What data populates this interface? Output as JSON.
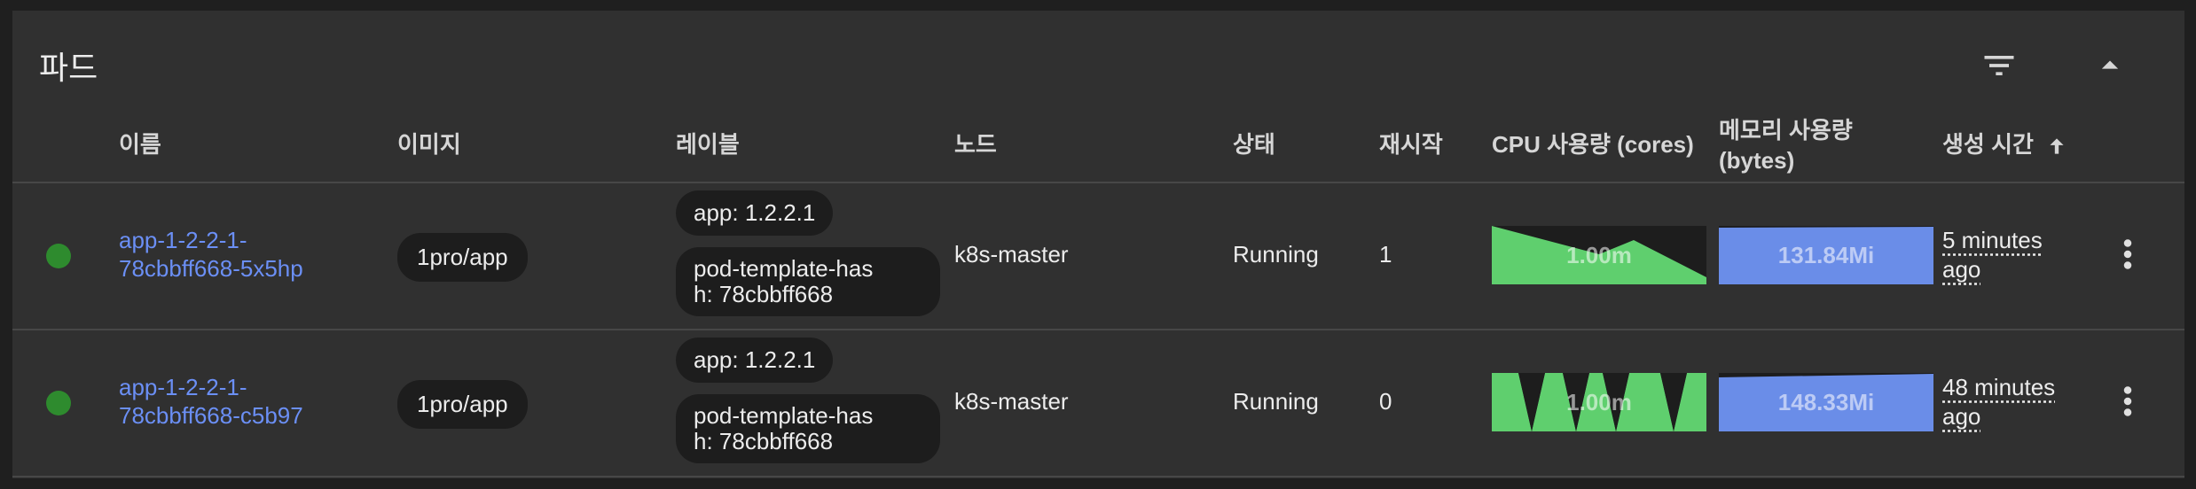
{
  "card": {
    "title": "파드",
    "icons": {
      "filter": "filter-icon",
      "collapse": "chevron-up-icon",
      "sort": "arrow-up-icon",
      "menu": "more-vert-icon"
    }
  },
  "columns": {
    "name": "이름",
    "image": "이미지",
    "labels": "레이블",
    "node": "노드",
    "status": "상태",
    "restarts": "재시작",
    "cpu": "CPU 사용량 (cores)",
    "memory_line1": "메모리 사용량",
    "memory_line2": "(bytes)",
    "created": "생성 시간"
  },
  "colors": {
    "status_running": "#2e8b2e",
    "link": "#6b8ff5",
    "cpu_fill": "#5fcf6e",
    "memory_fill": "#6a8de8"
  },
  "pods": [
    {
      "name_line1": "app-1-2-2-1-",
      "name_line2": "78cbbff668-5x5hp",
      "image": "1pro/app",
      "label_app": "app: 1.2.2.1",
      "label_hash": "pod-template-has\nh: 78cbbff668",
      "node": "k8s-master",
      "status": "Running",
      "restarts": "1",
      "cpu": "1.00m",
      "memory": "131.84Mi",
      "age_line1": "5 minutes",
      "age_line2": "ago"
    },
    {
      "name_line1": "app-1-2-2-1-",
      "name_line2": "78cbbff668-c5b97",
      "image": "1pro/app",
      "label_app": "app: 1.2.2.1",
      "label_hash": "pod-template-has\nh: 78cbbff668",
      "node": "k8s-master",
      "status": "Running",
      "restarts": "0",
      "cpu": "1.00m",
      "memory": "148.33Mi",
      "age_line1": "48 minutes",
      "age_line2": "ago"
    }
  ]
}
